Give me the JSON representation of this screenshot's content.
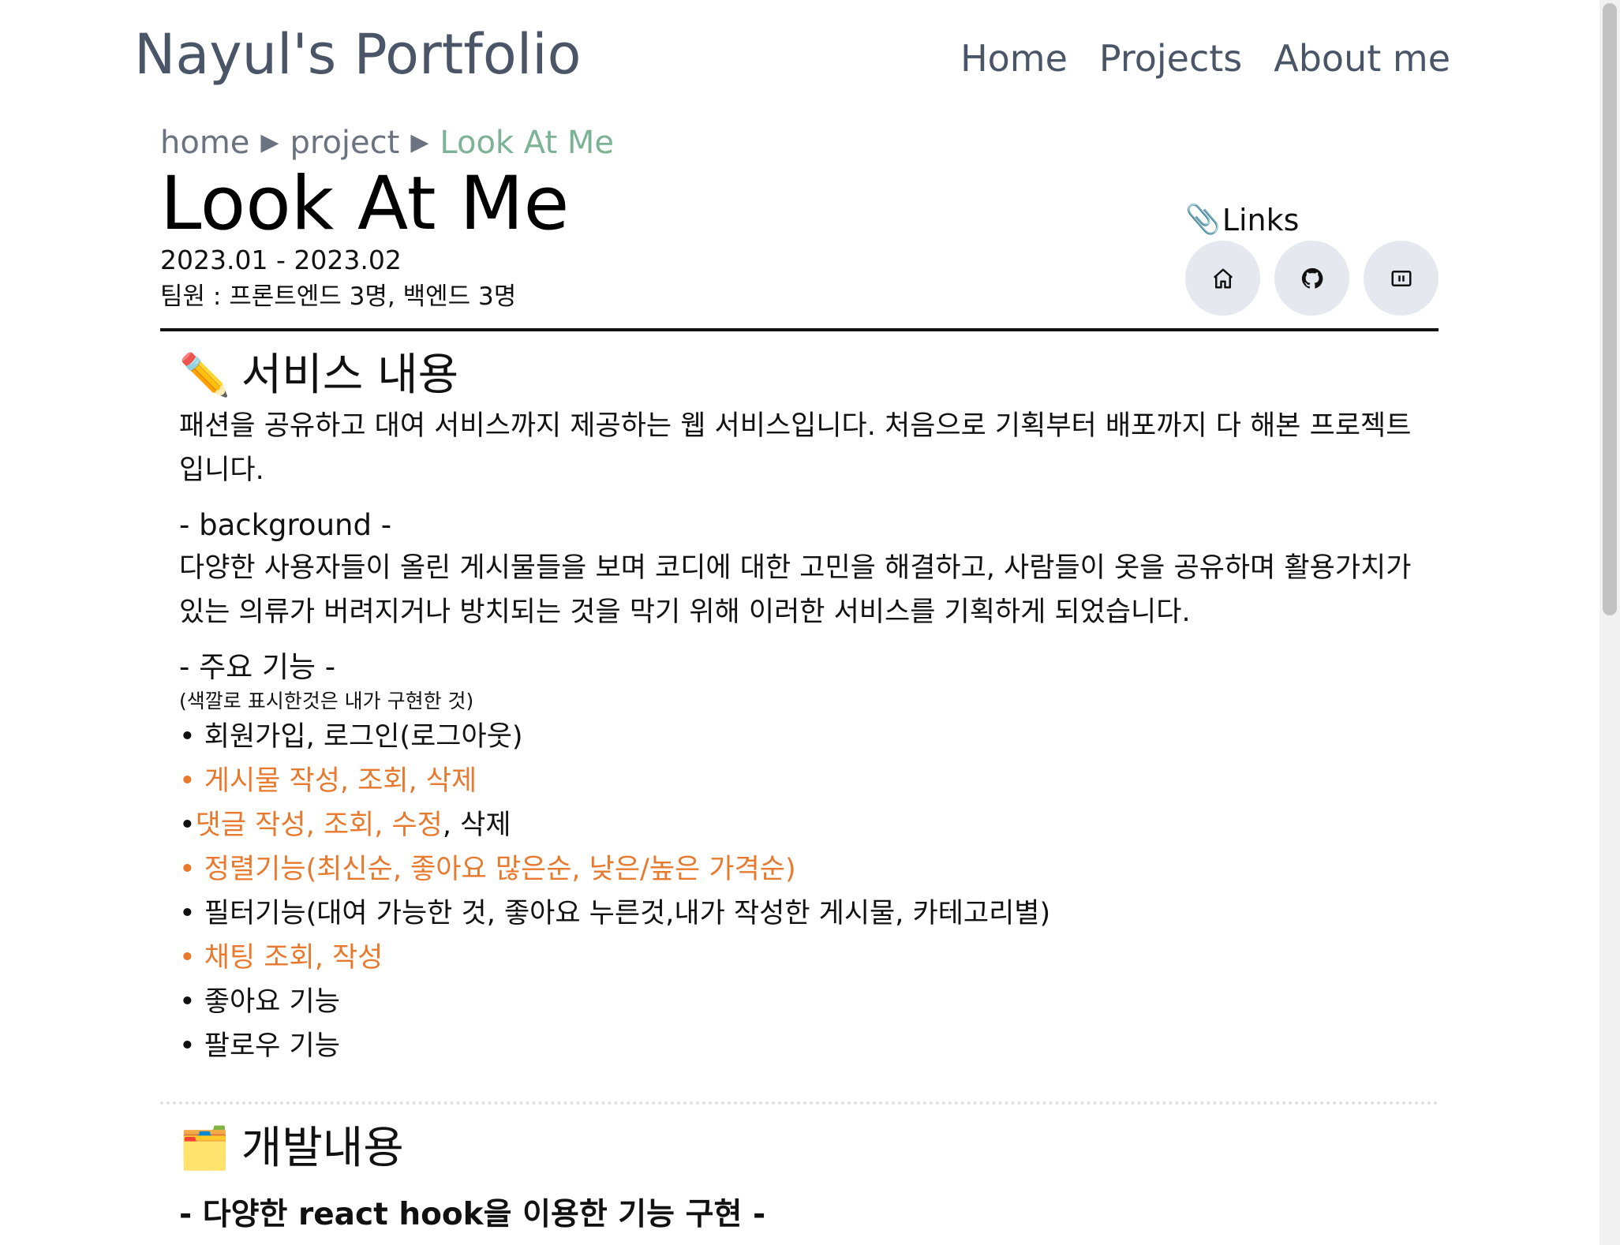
{
  "header": {
    "site_title": "Nayul's Portfolio",
    "nav": [
      "Home",
      "Projects",
      "About me"
    ]
  },
  "breadcrumb": {
    "items": [
      "home",
      "project",
      "Look At Me"
    ],
    "separator": "▶"
  },
  "project": {
    "title": "Look At Me",
    "period": "2023.01 - 2023.02",
    "team": "팀원 : 프론트엔드 3명, 백엔드 3명"
  },
  "links": {
    "label": "Links",
    "label_icon": "paperclip-icon",
    "buttons": [
      {
        "icon": "home-icon"
      },
      {
        "icon": "github-icon"
      },
      {
        "icon": "presentation-icon"
      }
    ]
  },
  "service": {
    "emoji": "✏️",
    "title": "서비스 내용",
    "intro": "패션을 공유하고 대여 서비스까지 제공하는 웹 서비스입니다. 처음으로 기획부터 배포까지 다 해본 프로젝트 입니다.",
    "background_head": "- background -",
    "background_text": "다양한 사용자들이 올린 게시물들을 보며 코디에 대한 고민을 해결하고, 사람들이 옷을 공유하며 활용가치가 있는 의류가 버려지거나 방치되는 것을 막기 위해 이러한 서비스를 기획하게 되었습니다.",
    "features_head": "- 주요 기능 -",
    "features_note": "(색깔로 표시한것은 내가 구현한 것)",
    "features": [
      {
        "bullet": "• ",
        "highlight": "",
        "text": "회원가입, 로그인(로그아웃)"
      },
      {
        "bullet": "• ",
        "highlight": "게시물 작성, 조회, 삭제",
        "text": ""
      },
      {
        "bullet": "•",
        "highlight": "댓글 작성, 조회, 수정",
        "text": ", 삭제"
      },
      {
        "bullet": "• ",
        "highlight": "정렬기능(최신순, 좋아요 많은순, 낮은/높은 가격순)",
        "text": ""
      },
      {
        "bullet": "• ",
        "highlight": "",
        "text": "필터기능(대여 가능한 것, 좋아요 누른것,내가 작성한 게시물, 카테고리별)"
      },
      {
        "bullet": "• ",
        "highlight": "채팅 조회, 작성",
        "text": ""
      },
      {
        "bullet": "• ",
        "highlight": "",
        "text": "좋아요 기능"
      },
      {
        "bullet": "• ",
        "highlight": "",
        "text": "팔로우 기능"
      }
    ]
  },
  "development": {
    "emoji": "🗂️",
    "title": "개발내용",
    "first_head": "- 다양한 react hook을 이용한 기능 구현 -"
  },
  "colors": {
    "nav_text": "#4a5568",
    "breadcrumb_current": "#7cb395",
    "highlight": "#e77a2f",
    "link_button_bg": "#e5e8ee"
  }
}
